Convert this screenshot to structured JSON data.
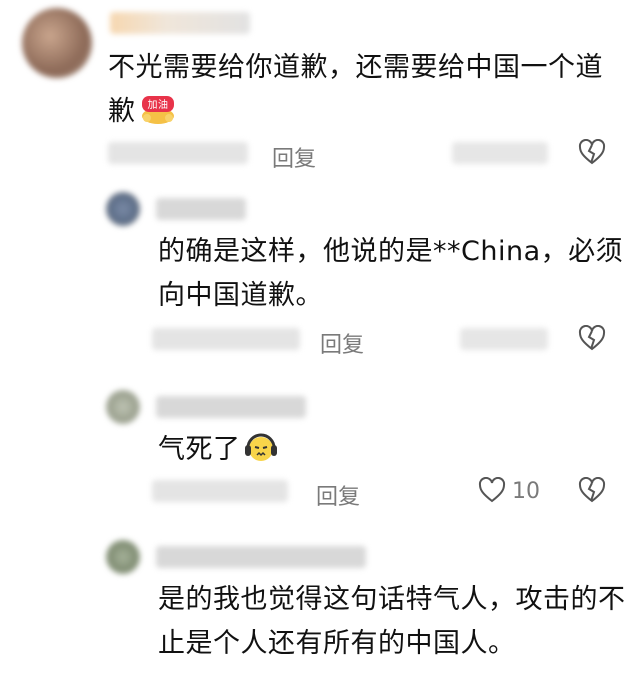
{
  "comments": [
    {
      "text_line1": "不光需要给你道歉，还需要给中国一个道",
      "text_line2": "歉",
      "emoji": "jiayou",
      "emoji_label": "加油",
      "reply_label": "回复"
    },
    {
      "text_line1": "的确是这样，他说的是**China，必须",
      "text_line2": "向中国道歉。",
      "reply_label": "回复"
    },
    {
      "text_line1": "气死了",
      "emoji": "headphones-face",
      "reply_label": "回复",
      "like_count": "10"
    },
    {
      "text_line1": "是的我也觉得这句话特气人，攻击的不",
      "text_line2": "止是个人还有所有的中国人。"
    }
  ],
  "colors": {
    "text": "#111111",
    "meta": "#7a7a7a",
    "accent_red": "#e8334a",
    "accent_gold": "#f5c146"
  }
}
